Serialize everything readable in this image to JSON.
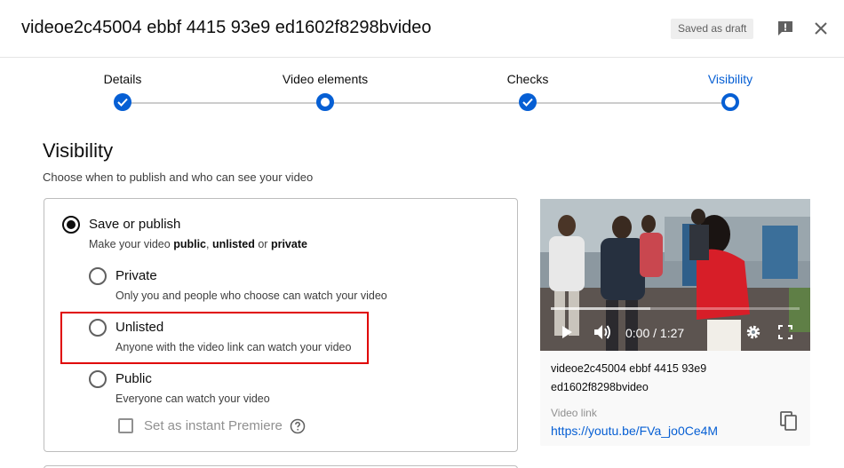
{
  "header": {
    "title": "videoe2c45004 ebbf 4415 93e9 ed1602f8298bvideo",
    "draft_badge": "Saved as draft",
    "feedback_icon": "feedback-icon",
    "close_icon": "close-icon"
  },
  "stepper": {
    "steps": [
      {
        "label": "Details",
        "state": "done"
      },
      {
        "label": "Video elements",
        "state": "current-edit"
      },
      {
        "label": "Checks",
        "state": "done"
      },
      {
        "label": "Visibility",
        "state": "active"
      }
    ]
  },
  "visibility": {
    "title": "Visibility",
    "subtitle": "Choose when to publish and who can see your video",
    "save_or_publish": {
      "label": "Save or publish",
      "desc_prefix": "Make your video ",
      "desc_public": "public",
      "desc_sep1": ", ",
      "desc_unlisted": "unlisted",
      "desc_sep2": " or ",
      "desc_private": "private",
      "selected": true
    },
    "options": [
      {
        "label": "Private",
        "desc": "Only you and people who choose can watch your video",
        "selected": false
      },
      {
        "label": "Unlisted",
        "desc": "Anyone with the video link can watch your video",
        "selected": false
      },
      {
        "label": "Public",
        "desc": "Everyone can watch your video",
        "selected": false
      }
    ],
    "instant_premiere": {
      "label": "Set as instant Premiere",
      "checked": false
    }
  },
  "preview": {
    "time": "0:00 / 1:27",
    "buffer_fraction": 0.4,
    "video_name": "videoe2c45004 ebbf 4415 93e9 ed1602f8298bvideo",
    "link_label": "Video link",
    "link": "https://youtu.be/FVa_jo0Ce4M"
  },
  "colors": {
    "accent": "#065fd4",
    "highlight": "#e00000"
  }
}
